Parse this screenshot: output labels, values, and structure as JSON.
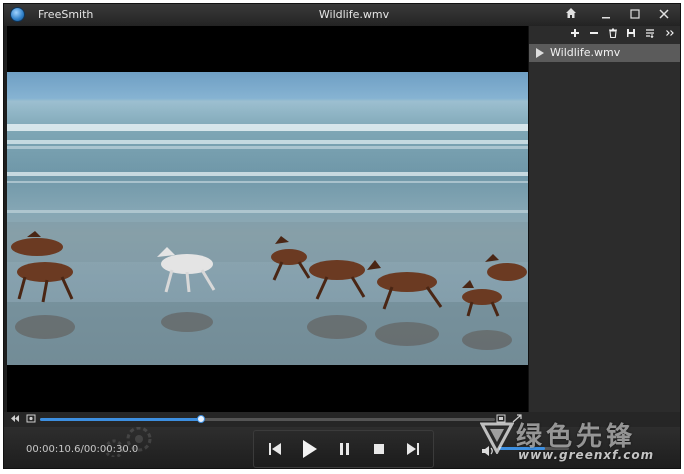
{
  "window": {
    "app_name": "FreeSmith",
    "file_title": "Wildlife.wmv"
  },
  "titlebar_icons": [
    "home-icon",
    "minimize-icon",
    "maximize-icon",
    "close-icon"
  ],
  "playlist": {
    "toolbar_icons": [
      "add-icon",
      "remove-icon",
      "delete-icon",
      "save-icon",
      "sort-icon",
      "more-icon"
    ],
    "items": [
      {
        "label": "Wildlife.wmv",
        "selected": true
      }
    ]
  },
  "playback": {
    "current_time": "00:00:10.6",
    "total_time": "00:00:30.0",
    "time_display": "00:00:10.6/00:00:30.0",
    "progress_fraction": 0.353,
    "volume_fraction": 0.65
  },
  "watermark": {
    "text": "绿色先锋",
    "url": "www.greenxf.com"
  },
  "colors": {
    "accent": "#3d8fe0",
    "panel_bg": "#2c2c2c",
    "selected_item": "#5b5b5b",
    "titlebar": "#2a2a2a"
  }
}
